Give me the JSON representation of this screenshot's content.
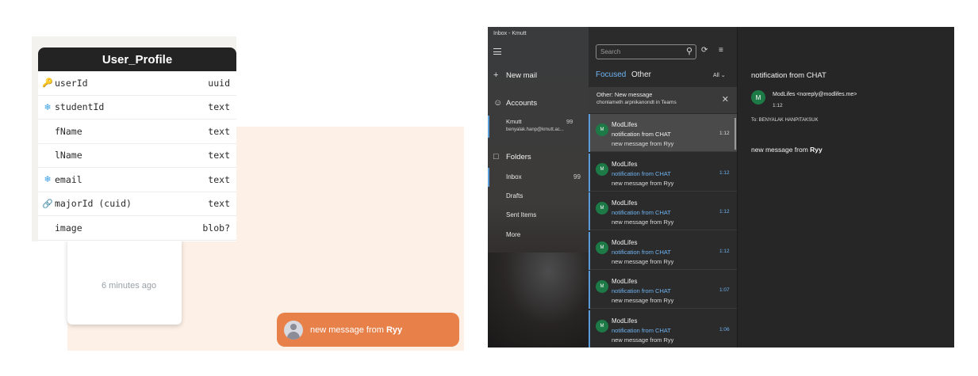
{
  "chat": {
    "time_ago": "6 minutes ago",
    "toast": {
      "prefix": "new message from ",
      "sender": "Ryy"
    }
  },
  "db_table": {
    "title": "User_Profile",
    "columns": [
      {
        "icon": "key-icon",
        "name": "userId",
        "type": "uuid"
      },
      {
        "icon": "snowflake-icon",
        "name": "studentId",
        "type": "text"
      },
      {
        "icon": "",
        "name": "fName",
        "type": "text"
      },
      {
        "icon": "",
        "name": "lName",
        "type": "text"
      },
      {
        "icon": "snowflake-icon",
        "name": "email",
        "type": "text"
      },
      {
        "icon": "link-icon",
        "name": "majorId (cuid)",
        "type": "text"
      },
      {
        "icon": "",
        "name": "image",
        "type": "blob?"
      }
    ]
  },
  "mail": {
    "window_title": "Inbox - Kmutt",
    "nav": {
      "new_mail": "New mail",
      "accounts": "Accounts",
      "account_name": "Kmutt",
      "account_count": "99",
      "account_email": "benyalak.hanp@kmutt.ac...",
      "folders": "Folders",
      "folder_items": [
        {
          "label": "Inbox",
          "count": "99"
        },
        {
          "label": "Drafts",
          "count": ""
        },
        {
          "label": "Sent Items",
          "count": ""
        },
        {
          "label": "More",
          "count": ""
        }
      ]
    },
    "list": {
      "search_placeholder": "Search",
      "tab_focused": "Focused",
      "tab_other": "Other",
      "filter_label": "All",
      "other_banner": {
        "title": "Other: New message",
        "subtitle": "chonlameth arpnikanondt in Teams"
      },
      "messages": [
        {
          "avatar": "M",
          "from": "ModLifes",
          "subject": "notification from CHAT",
          "preview": "new message from Ryy",
          "time": "1:12"
        },
        {
          "avatar": "M",
          "from": "ModLifes",
          "subject": "notification from CHAT",
          "preview": "new message from Ryy",
          "time": "1:12"
        },
        {
          "avatar": "M",
          "from": "ModLifes",
          "subject": "notification from CHAT",
          "preview": "new message from Ryy",
          "time": "1:12"
        },
        {
          "avatar": "M",
          "from": "ModLifes",
          "subject": "notification from CHAT",
          "preview": "new message from Ryy",
          "time": "1:12"
        },
        {
          "avatar": "M",
          "from": "ModLifes",
          "subject": "notification from CHAT",
          "preview": "new message from Ryy",
          "time": "1:07"
        },
        {
          "avatar": "M",
          "from": "ModLifes",
          "subject": "notification from CHAT",
          "preview": "new message from Ryy",
          "time": "1:06"
        }
      ]
    },
    "reading": {
      "subject": "notification from CHAT",
      "avatar": "M",
      "from": "ModLifes <noreply@modlifes.me>",
      "time": "1:12",
      "to": "To: BENYALAK HANPITAKSUK",
      "body_prefix": "new message from ",
      "body_sender": "Ryy"
    }
  }
}
